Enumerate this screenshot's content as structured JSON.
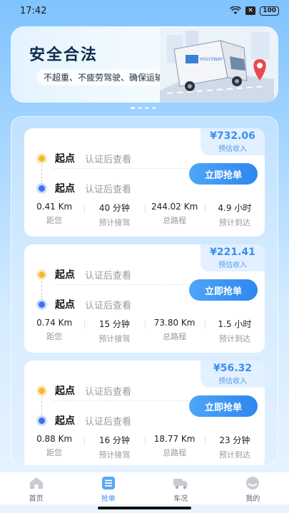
{
  "status_bar": {
    "time": "17:42",
    "battery": "100",
    "badge": "✕"
  },
  "banner": {
    "title": "安全合法",
    "subtitle": "不超重、不疲劳驾驶、确保运输安全",
    "truck_text": "HOLYSWAY"
  },
  "orders": [
    {
      "start_label": "起点",
      "start_value": "认证后查看",
      "end_label": "起点",
      "end_value": "认证后查看",
      "price": "¥732.06",
      "price_label": "预估收入",
      "button": "立即抢单",
      "stats": [
        {
          "value": "0.41 Km",
          "label": "距您"
        },
        {
          "value": "40 分钟",
          "label": "预计接驾"
        },
        {
          "value": "244.02 Km",
          "label": "总路程"
        },
        {
          "value": "4.9 小时",
          "label": "预计到达"
        }
      ]
    },
    {
      "start_label": "起点",
      "start_value": "认证后查看",
      "end_label": "起点",
      "end_value": "认证后查看",
      "price": "¥221.41",
      "price_label": "预估收入",
      "button": "立即抢单",
      "stats": [
        {
          "value": "0.74 Km",
          "label": "距您"
        },
        {
          "value": "15 分钟",
          "label": "预计接驾"
        },
        {
          "value": "73.80 Km",
          "label": "总路程"
        },
        {
          "value": "1.5 小时",
          "label": "预计到达"
        }
      ]
    },
    {
      "start_label": "起点",
      "start_value": "认证后查看",
      "end_label": "起点",
      "end_value": "认证后查看",
      "price": "¥56.32",
      "price_label": "预估收入",
      "button": "立即抢单",
      "stats": [
        {
          "value": "0.88 Km",
          "label": "距您"
        },
        {
          "value": "16 分钟",
          "label": "预计接驾"
        },
        {
          "value": "18.77 Km",
          "label": "总路程"
        },
        {
          "value": "23 分钟",
          "label": "预计到达"
        }
      ]
    }
  ],
  "tabbar": [
    {
      "label": "首页",
      "icon": "home-icon",
      "active": false
    },
    {
      "label": "抢单",
      "icon": "list-icon",
      "active": true
    },
    {
      "label": "车况",
      "icon": "truck-icon",
      "active": false
    },
    {
      "label": "我的",
      "icon": "profile-icon",
      "active": false
    }
  ],
  "colors": {
    "accent": "#3a8ff0",
    "start_dot": "#f5b833",
    "end_dot": "#3d72f0"
  }
}
